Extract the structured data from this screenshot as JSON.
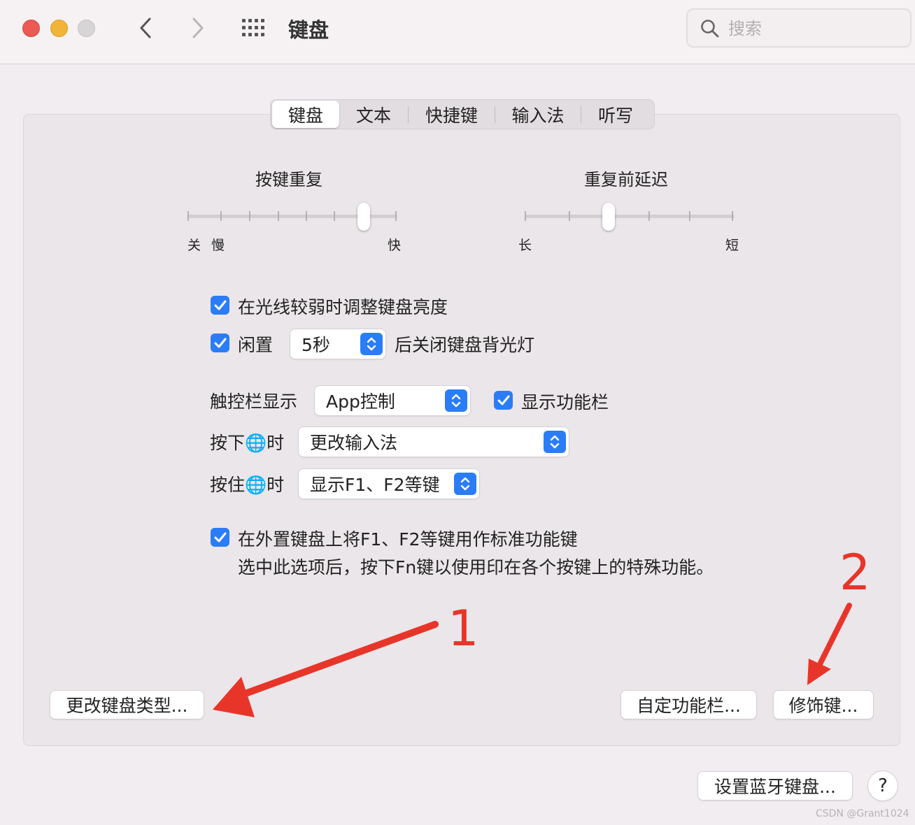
{
  "window": {
    "title": "键盘",
    "search_placeholder": "搜索"
  },
  "tabs": [
    {
      "label": "键盘",
      "active": true
    },
    {
      "label": "文本",
      "active": false
    },
    {
      "label": "快捷键",
      "active": false
    },
    {
      "label": "输入法",
      "active": false
    },
    {
      "label": "听写",
      "active": false
    }
  ],
  "key_repeat": {
    "title": "按键重复",
    "labels": {
      "off": "关",
      "slow": "慢",
      "fast": "快"
    },
    "value_fraction": 0.84
  },
  "delay_until_repeat": {
    "title": "重复前延迟",
    "labels": {
      "long": "长",
      "short": "短"
    },
    "value_fraction": 0.4
  },
  "options": {
    "adjust_brightness": {
      "checked": true,
      "label": "在光线较弱时调整键盘亮度"
    },
    "backlight_off": {
      "checked": true,
      "label_before": "闲置",
      "popup_value": "5秒",
      "label_after": "后关闭键盘背光灯"
    },
    "touch_bar": {
      "label": "触控栏显示",
      "popup_value": "App控制",
      "show_control_strip": {
        "checked": true,
        "label": "显示功能栏"
      }
    },
    "press_globe": {
      "label": "按下🌐时",
      "popup_value": "更改输入法"
    },
    "hold_globe": {
      "label": "按住🌐时",
      "popup_value": "显示F1、F2等键"
    },
    "fn_keys": {
      "checked": true,
      "label": "在外置键盘上将F1、F2等键用作标准功能键",
      "description": "选中此选项后，按下Fn键以使用印在各个按键上的特殊功能。"
    }
  },
  "buttons": {
    "change_keyboard_type": "更改键盘类型...",
    "customize_control_strip": "自定功能栏...",
    "modifier_keys": "修饰键...",
    "setup_bluetooth_keyboard": "设置蓝牙键盘...",
    "help": "?"
  },
  "annotations": {
    "arrow1_label": "1",
    "arrow2_label": "2",
    "color": "#e8352a"
  },
  "watermark": "CSDN @Grant1024",
  "colors": {
    "accent": "#2a7df6",
    "window_bg": "#f1edf0",
    "panel_bg": "#ebe6e9"
  }
}
